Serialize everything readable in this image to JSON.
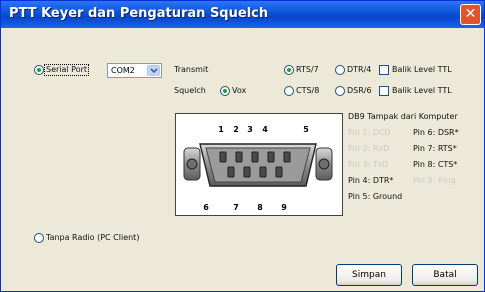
{
  "window": {
    "title": "PTT Keyer dan Pengaturan Squelch",
    "close_glyph": "✕"
  },
  "options": {
    "serial_port_label": "Serial Port",
    "serial_port_selected": true,
    "com_value": "COM2",
    "pc_client_label": "Tanpa Radio (PC Client)",
    "pc_client_selected": false
  },
  "transmit": {
    "label": "Transmit",
    "rts_label": "RTS/7",
    "rts_selected": true,
    "dtr_label": "DTR/4",
    "dtr_selected": false,
    "invert_label": "Balik Level TTL",
    "invert_checked": false
  },
  "squelch": {
    "label": "Squelch",
    "vox_label": "Vox",
    "vox_selected": true,
    "cts_label": "CTS/8",
    "cts_selected": false,
    "dsr_label": "DSR/6",
    "dsr_selected": false,
    "invert_label": "Balik Level TTL",
    "invert_checked": false
  },
  "pinout": {
    "title": "DB9 Tampak dari Komputer",
    "pin_numbers": [
      "1",
      "2",
      "3",
      "4",
      "5",
      "6",
      "7",
      "8",
      "9"
    ],
    "pins": [
      {
        "text": "Pin 1: DCD",
        "active": false
      },
      {
        "text": "Pin 6: DSR*",
        "active": true
      },
      {
        "text": "Pin 2: RxD",
        "active": false
      },
      {
        "text": "Pin 7: RTS*",
        "active": true
      },
      {
        "text": "Pin 3: TxD",
        "active": false
      },
      {
        "text": "Pin 8: CTS*",
        "active": true
      },
      {
        "text": "Pin 4: DTR*",
        "active": true
      },
      {
        "text": "Pin 9: Ring",
        "active": false
      },
      {
        "text": "Pin 5: Ground",
        "active": true
      }
    ]
  },
  "buttons": {
    "save": "Simpan",
    "cancel": "Batal"
  }
}
